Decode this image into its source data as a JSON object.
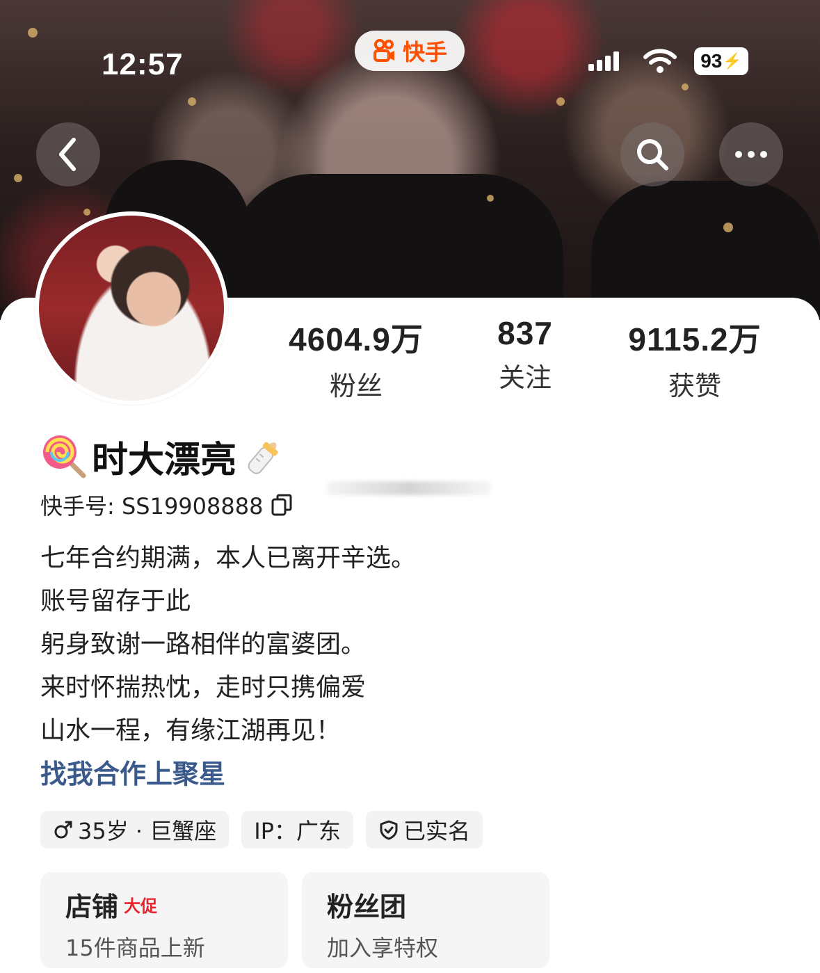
{
  "status_bar": {
    "time": "12:57",
    "app_name": "快手",
    "battery": "93"
  },
  "header": {
    "back_icon": "chevron-left-icon",
    "search_icon": "search-icon",
    "more_icon": "more-dots-icon"
  },
  "stats": [
    {
      "value": "4604.9万",
      "label": "粉丝"
    },
    {
      "value": "837",
      "label": "关注"
    },
    {
      "value": "9115.2万",
      "label": "获赞"
    }
  ],
  "profile": {
    "nickname": "时大漂亮",
    "id_label": "快手号: SS19908888",
    "bio": [
      "七年合约期满，本人已离开辛选。",
      "账号留存于此",
      "躬身致谢一路相伴的富婆团。",
      "来时怀揣热忱，走时只携偏爱",
      "山水一程，有缘江湖再见！"
    ],
    "link_text": "找我合作上聚星"
  },
  "tags": [
    {
      "icon": "male-icon",
      "text": "35岁 · 巨蟹座"
    },
    {
      "icon": "",
      "text": "IP：广东"
    },
    {
      "icon": "shield-check-icon",
      "text": "已实名"
    }
  ],
  "tiles": [
    {
      "title": "店铺",
      "badge": "大促",
      "subtitle": "15件商品上新"
    },
    {
      "title": "粉丝团",
      "badge": "",
      "subtitle": "加入享特权"
    }
  ],
  "colors": {
    "brand": "#ff5000",
    "link": "#3a5a8c",
    "badge": "#e8232d"
  }
}
